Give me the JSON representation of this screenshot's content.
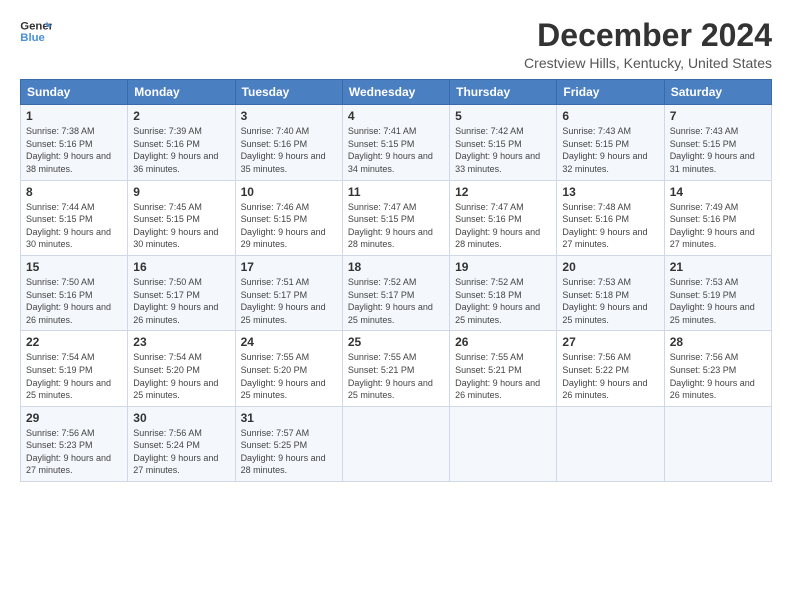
{
  "logo": {
    "line1": "General",
    "line2": "Blue"
  },
  "title": "December 2024",
  "subtitle": "Crestview Hills, Kentucky, United States",
  "days_of_week": [
    "Sunday",
    "Monday",
    "Tuesday",
    "Wednesday",
    "Thursday",
    "Friday",
    "Saturday"
  ],
  "weeks": [
    [
      {
        "day": "1",
        "sunrise": "7:38 AM",
        "sunset": "5:16 PM",
        "daylight": "9 hours and 38 minutes."
      },
      {
        "day": "2",
        "sunrise": "7:39 AM",
        "sunset": "5:16 PM",
        "daylight": "9 hours and 36 minutes."
      },
      {
        "day": "3",
        "sunrise": "7:40 AM",
        "sunset": "5:16 PM",
        "daylight": "9 hours and 35 minutes."
      },
      {
        "day": "4",
        "sunrise": "7:41 AM",
        "sunset": "5:15 PM",
        "daylight": "9 hours and 34 minutes."
      },
      {
        "day": "5",
        "sunrise": "7:42 AM",
        "sunset": "5:15 PM",
        "daylight": "9 hours and 33 minutes."
      },
      {
        "day": "6",
        "sunrise": "7:43 AM",
        "sunset": "5:15 PM",
        "daylight": "9 hours and 32 minutes."
      },
      {
        "day": "7",
        "sunrise": "7:43 AM",
        "sunset": "5:15 PM",
        "daylight": "9 hours and 31 minutes."
      }
    ],
    [
      {
        "day": "8",
        "sunrise": "7:44 AM",
        "sunset": "5:15 PM",
        "daylight": "9 hours and 30 minutes."
      },
      {
        "day": "9",
        "sunrise": "7:45 AM",
        "sunset": "5:15 PM",
        "daylight": "9 hours and 30 minutes."
      },
      {
        "day": "10",
        "sunrise": "7:46 AM",
        "sunset": "5:15 PM",
        "daylight": "9 hours and 29 minutes."
      },
      {
        "day": "11",
        "sunrise": "7:47 AM",
        "sunset": "5:15 PM",
        "daylight": "9 hours and 28 minutes."
      },
      {
        "day": "12",
        "sunrise": "7:47 AM",
        "sunset": "5:16 PM",
        "daylight": "9 hours and 28 minutes."
      },
      {
        "day": "13",
        "sunrise": "7:48 AM",
        "sunset": "5:16 PM",
        "daylight": "9 hours and 27 minutes."
      },
      {
        "day": "14",
        "sunrise": "7:49 AM",
        "sunset": "5:16 PM",
        "daylight": "9 hours and 27 minutes."
      }
    ],
    [
      {
        "day": "15",
        "sunrise": "7:50 AM",
        "sunset": "5:16 PM",
        "daylight": "9 hours and 26 minutes."
      },
      {
        "day": "16",
        "sunrise": "7:50 AM",
        "sunset": "5:17 PM",
        "daylight": "9 hours and 26 minutes."
      },
      {
        "day": "17",
        "sunrise": "7:51 AM",
        "sunset": "5:17 PM",
        "daylight": "9 hours and 25 minutes."
      },
      {
        "day": "18",
        "sunrise": "7:52 AM",
        "sunset": "5:17 PM",
        "daylight": "9 hours and 25 minutes."
      },
      {
        "day": "19",
        "sunrise": "7:52 AM",
        "sunset": "5:18 PM",
        "daylight": "9 hours and 25 minutes."
      },
      {
        "day": "20",
        "sunrise": "7:53 AM",
        "sunset": "5:18 PM",
        "daylight": "9 hours and 25 minutes."
      },
      {
        "day": "21",
        "sunrise": "7:53 AM",
        "sunset": "5:19 PM",
        "daylight": "9 hours and 25 minutes."
      }
    ],
    [
      {
        "day": "22",
        "sunrise": "7:54 AM",
        "sunset": "5:19 PM",
        "daylight": "9 hours and 25 minutes."
      },
      {
        "day": "23",
        "sunrise": "7:54 AM",
        "sunset": "5:20 PM",
        "daylight": "9 hours and 25 minutes."
      },
      {
        "day": "24",
        "sunrise": "7:55 AM",
        "sunset": "5:20 PM",
        "daylight": "9 hours and 25 minutes."
      },
      {
        "day": "25",
        "sunrise": "7:55 AM",
        "sunset": "5:21 PM",
        "daylight": "9 hours and 25 minutes."
      },
      {
        "day": "26",
        "sunrise": "7:55 AM",
        "sunset": "5:21 PM",
        "daylight": "9 hours and 26 minutes."
      },
      {
        "day": "27",
        "sunrise": "7:56 AM",
        "sunset": "5:22 PM",
        "daylight": "9 hours and 26 minutes."
      },
      {
        "day": "28",
        "sunrise": "7:56 AM",
        "sunset": "5:23 PM",
        "daylight": "9 hours and 26 minutes."
      }
    ],
    [
      {
        "day": "29",
        "sunrise": "7:56 AM",
        "sunset": "5:23 PM",
        "daylight": "9 hours and 27 minutes."
      },
      {
        "day": "30",
        "sunrise": "7:56 AM",
        "sunset": "5:24 PM",
        "daylight": "9 hours and 27 minutes."
      },
      {
        "day": "31",
        "sunrise": "7:57 AM",
        "sunset": "5:25 PM",
        "daylight": "9 hours and 28 minutes."
      },
      null,
      null,
      null,
      null
    ]
  ]
}
